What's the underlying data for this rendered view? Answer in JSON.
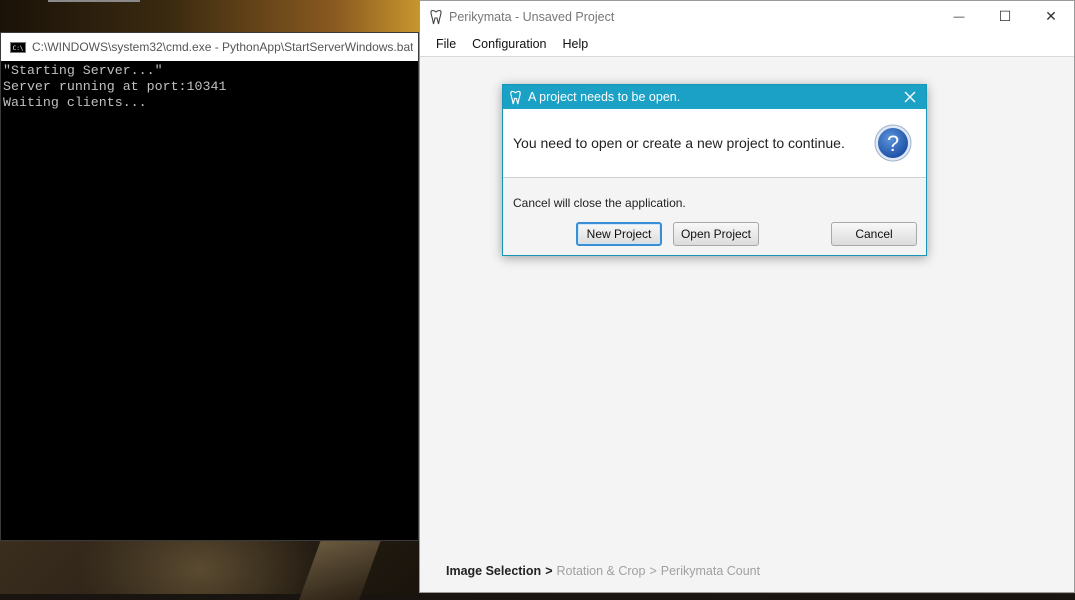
{
  "cmd": {
    "title": "C:\\WINDOWS\\system32\\cmd.exe - PythonApp\\StartServerWindows.bat",
    "icon_label": "C:\\",
    "lines": [
      "\"Starting Server...\"",
      "Server running at port:10341",
      "Waiting clients..."
    ]
  },
  "app": {
    "title": "Perikymata - Unsaved Project",
    "menu": [
      "File",
      "Configuration",
      "Help"
    ],
    "window_controls": {
      "minimize": "—",
      "maximize": "☐",
      "close": "✕"
    },
    "breadcrumb": {
      "active": "Image Selection",
      "separator": ">",
      "steps": [
        "Rotation & Crop",
        "Perikymata Count"
      ]
    }
  },
  "dialog": {
    "title": "A project needs to be open.",
    "message": "You need to open or create a new project to continue.",
    "note": "Cancel will close the application.",
    "buttons": {
      "new_project": "New Project",
      "open_project": "Open Project",
      "cancel": "Cancel"
    },
    "question_mark": "?"
  },
  "colors": {
    "dialog_title_bg": "#1ba0c6",
    "question_icon": "#2a66b8",
    "default_button_border": "#3a8fd4"
  }
}
